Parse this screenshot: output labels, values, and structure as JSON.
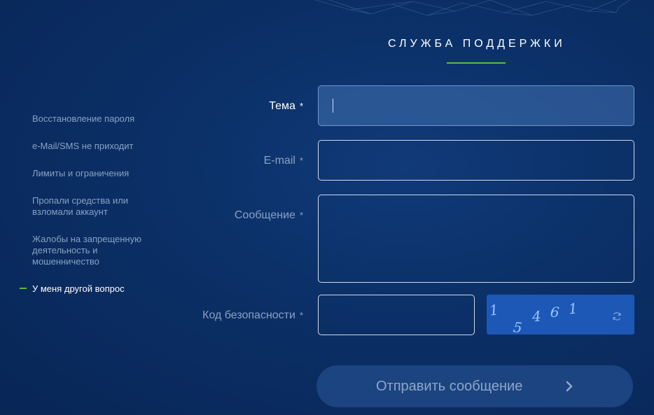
{
  "page_title": "СЛУЖБА ПОДДЕРЖКИ",
  "sidebar": {
    "items": [
      {
        "label": "Восстановление пароля"
      },
      {
        "label": "e-Mail/SMS не приходит"
      },
      {
        "label": "Лимиты и ограничения"
      },
      {
        "label": "Пропали средства или взломали аккаунт"
      },
      {
        "label": "Жалобы на запрещенную деятельность и мошенничество"
      },
      {
        "label": "У меня другой вопрос",
        "active": true
      }
    ]
  },
  "form": {
    "subject": {
      "label": "Тема",
      "required_mark": "*",
      "value": ""
    },
    "email": {
      "label": "E-mail",
      "required_mark": "*",
      "value": ""
    },
    "message": {
      "label": "Сообщение",
      "required_mark": "*",
      "value": ""
    },
    "security_code": {
      "label": "Код безопасности",
      "required_mark": "*",
      "value": ""
    },
    "captcha": {
      "digits": [
        "1",
        "5",
        "4",
        "6",
        "1"
      ],
      "refresh_icon": "refresh-icon"
    },
    "submit": {
      "label": "Отправить сообщение",
      "icon": "chevron-right-icon"
    }
  },
  "colors": {
    "accent": "#54c144",
    "background": "#0b2f66",
    "captcha_bg": "#1d58b6"
  }
}
